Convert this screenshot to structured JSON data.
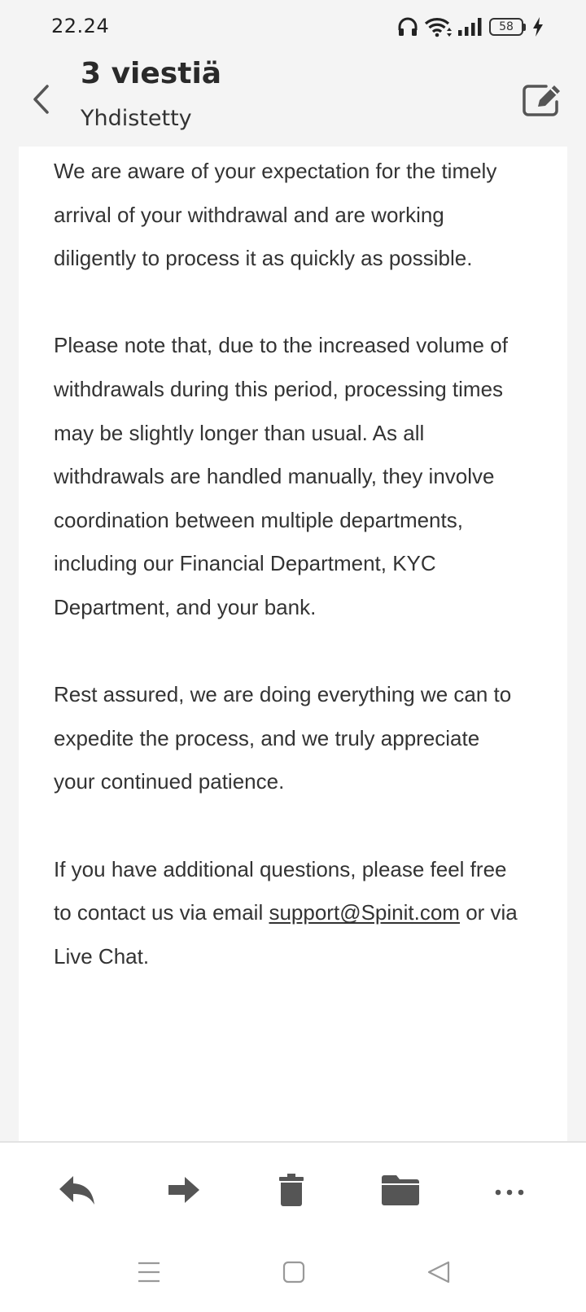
{
  "status_bar": {
    "time": "22.24",
    "battery": "58",
    "icons": [
      "headphones-icon",
      "wifi-icon",
      "signal-icon",
      "battery-icon",
      "charging-icon"
    ]
  },
  "header": {
    "title": "3 viestiä",
    "subtitle": "Yhdistetty",
    "back_icon": "chevron-left-icon",
    "compose_icon": "edit-icon"
  },
  "message": {
    "paragraphs": [
      "We are aware of your expectation for the timely arrival of your withdrawal and are working diligently to process it as quickly as possible.",
      "Please note that, due to the increased volume of withdrawals during this period, processing times may be slightly longer than usual.  As all withdrawals are handled manually, they involve coordination between multiple departments, including our Financial Department, KYC Department, and your bank.",
      "Rest assured, we are doing everything we can to expedite the process, and we truly appreciate your continued patience."
    ],
    "closing": {
      "before_link": "If you have additional questions, please feel free to contact us via email ",
      "link": "support@Spinit.com",
      "after_link": " or via Live Chat."
    }
  },
  "toolbar": {
    "actions": [
      "reply-icon",
      "forward-icon",
      "delete-icon",
      "folder-icon",
      "more-icon"
    ]
  },
  "nav_bar": {
    "buttons": [
      "menu-icon",
      "home-icon",
      "back-triangle-icon"
    ]
  },
  "colors": {
    "background": "#f4f4f4",
    "card": "#ffffff",
    "text": "#333333",
    "icon": "#555555"
  }
}
